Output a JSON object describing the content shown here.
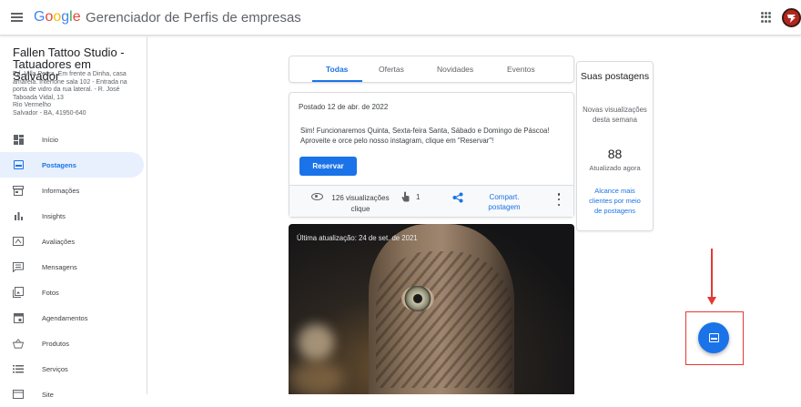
{
  "header": {
    "logo_letters": [
      "G",
      "o",
      "o",
      "g",
      "l",
      "e"
    ],
    "product_name": "Gerenciador de Perfis de empresas",
    "menu_icon": "hamburger-menu-icon",
    "apps_icon": "apps-grid-icon",
    "avatar_icon": "account-avatar-icon"
  },
  "business": {
    "name": "Fallen Tattoo Studio - Tatuadores em Salvador",
    "address": "Ed. Villa Persa. Em frente a Dinha, casa amarela. Interfone sala 102 - Entrada na porta de vidro da rua lateral. - R. José Taboada Vidal, 13\nRio Vermelho\nSalvador - BA, 41950-640"
  },
  "sidebar": {
    "items": [
      {
        "label": "Início",
        "icon": "dashboard-icon",
        "active": false
      },
      {
        "label": "Postagens",
        "icon": "posts-icon",
        "active": true
      },
      {
        "label": "Informações",
        "icon": "storefront-icon",
        "active": false
      },
      {
        "label": "Insights",
        "icon": "bar-chart-icon",
        "active": false
      },
      {
        "label": "Avaliações",
        "icon": "reviews-icon",
        "active": false
      },
      {
        "label": "Mensagens",
        "icon": "message-icon",
        "active": false
      },
      {
        "label": "Fotos",
        "icon": "photo-library-icon",
        "active": false
      },
      {
        "label": "Agendamentos",
        "icon": "calendar-icon",
        "active": false
      },
      {
        "label": "Produtos",
        "icon": "basket-icon",
        "active": false
      },
      {
        "label": "Serviços",
        "icon": "list-icon",
        "active": false
      },
      {
        "label": "Site",
        "icon": "web-icon",
        "active": false
      }
    ]
  },
  "tabs": [
    {
      "label": "Todas",
      "active": true
    },
    {
      "label": "Ofertas",
      "active": false
    },
    {
      "label": "Novidades",
      "active": false
    },
    {
      "label": "Eventos",
      "active": false
    }
  ],
  "post": {
    "date": "Postado 12 de abr. de 2022",
    "text": "Sim! Funcionaremos Quinta, Sexta-feira Santa, Sábado e Domingo de Páscoa! Aproveite e orce pelo nosso instagram, clique em \"Reservar\"!",
    "button_label": "Reservar",
    "views": "126 visualizações",
    "clicks_count": "1",
    "clicks_label": "clique",
    "share_label": "Compart. postagem"
  },
  "photo_post": {
    "update_text": "Última atualização: 24 de set. de 2021"
  },
  "stats": {
    "title": "Suas postagens",
    "label": "Novas visualizações desta semana",
    "number": "88",
    "sub": "Atualizado agora",
    "link": "Alcance mais clientes por meio de postagens"
  },
  "annotation_color": "#e53935",
  "accent_color": "#1a73e8"
}
